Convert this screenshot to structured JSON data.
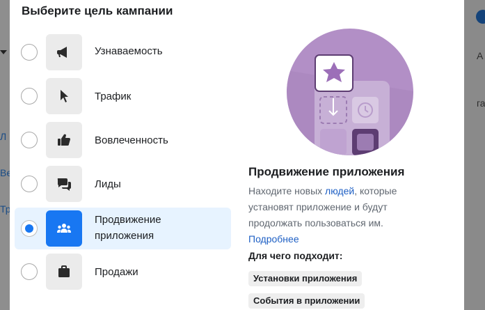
{
  "background": {
    "left_fragments": [
      "Л",
      "Ве",
      "Тр"
    ],
    "right_fragments": [
      "А",
      "га"
    ]
  },
  "modal": {
    "title": "Выберите цель кампании",
    "options": [
      {
        "label": "Узнаваемость",
        "icon": "megaphone-icon",
        "selected": false
      },
      {
        "label": "Трафик",
        "icon": "cursor-icon",
        "selected": false
      },
      {
        "label": "Вовлеченность",
        "icon": "thumbs-up-icon",
        "selected": false
      },
      {
        "label": "Лиды",
        "icon": "chat-bubbles-icon",
        "selected": false
      },
      {
        "label": "Продвижение приложения",
        "label_line1": "Продвижение",
        "label_line2": "приложения",
        "icon": "people-icon",
        "selected": true
      },
      {
        "label": "Продажи",
        "icon": "shopping-bag-icon",
        "selected": false
      }
    ],
    "detail": {
      "title": "Продвижение приложения",
      "desc_part1": "Находите новых ",
      "desc_link": "людей",
      "desc_part2": ", которые установят приложение и будут продолжать пользоваться им.",
      "more_link": "Подробнее",
      "suited_title": "Для чего подходит:",
      "chips": [
        "Установки приложения",
        "События в приложении"
      ]
    }
  },
  "colors": {
    "accent": "#1877f2",
    "selected_row": "#e7f3ff",
    "illustration": "#b28fc6"
  }
}
